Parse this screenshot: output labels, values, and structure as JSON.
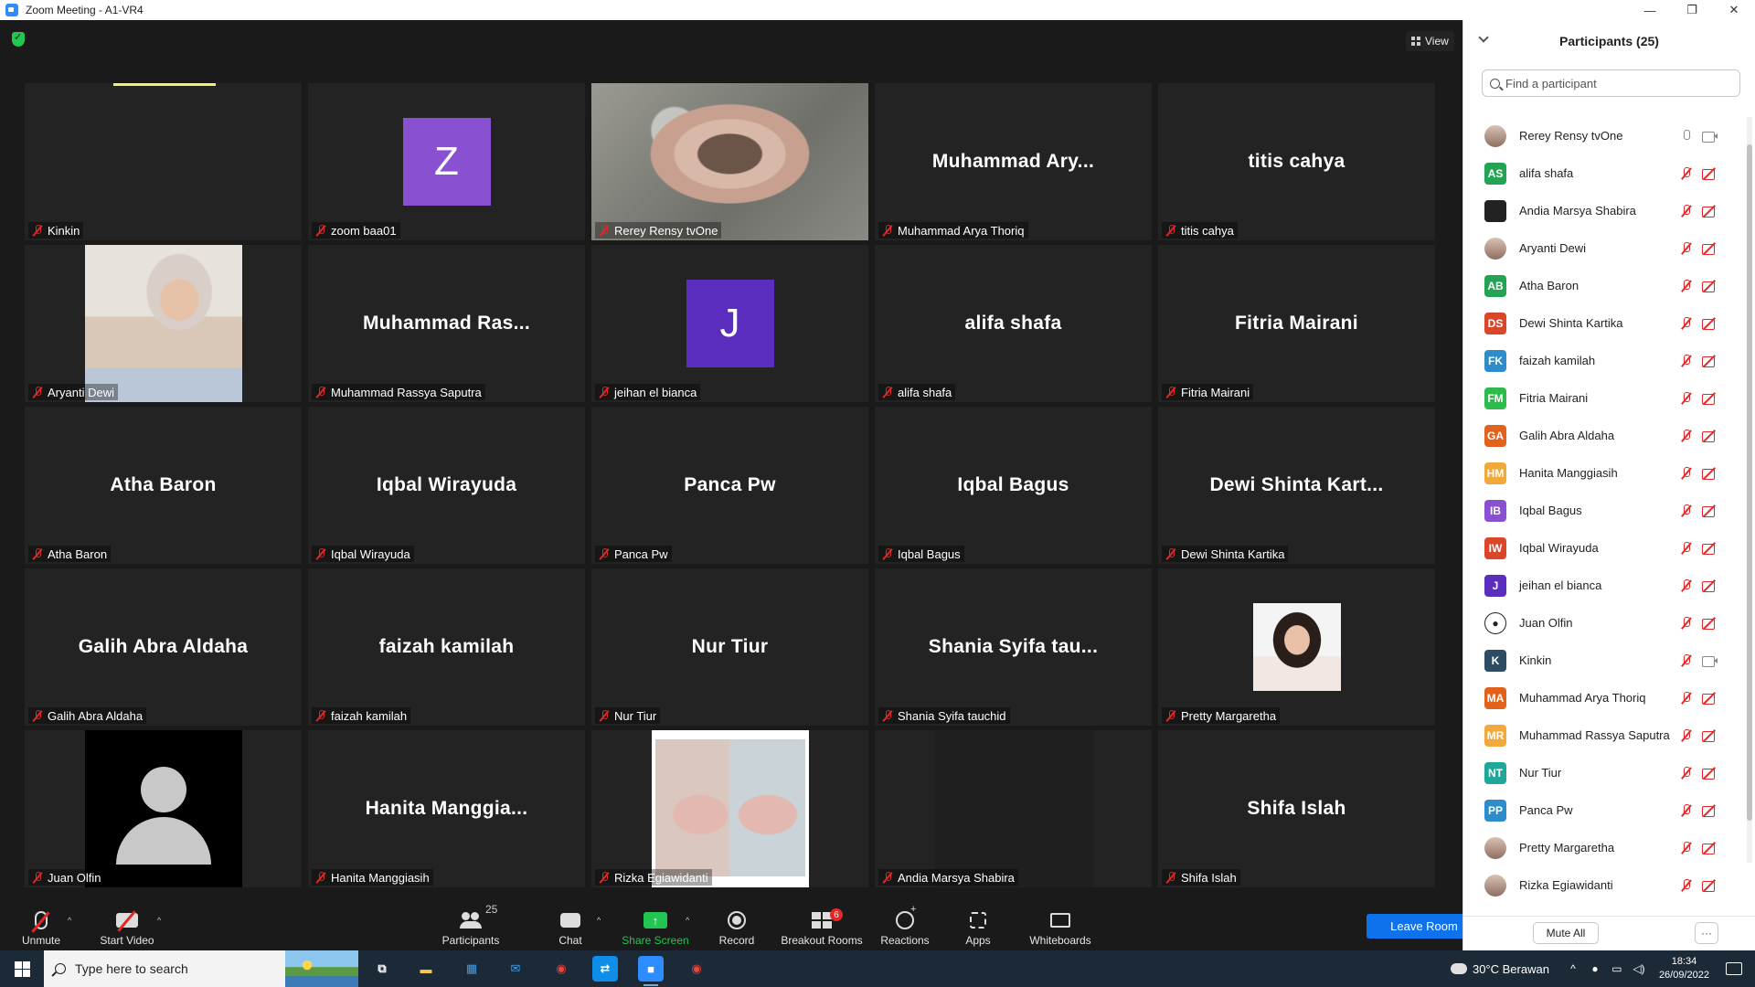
{
  "window": {
    "title": "Zoom Meeting - A1-VR4",
    "minimize_glyph": "—",
    "restore_glyph": "❐",
    "close_glyph": "✕"
  },
  "meeting": {
    "view_label": "View",
    "security_icon": "shield-check-icon"
  },
  "tiles": [
    {
      "name": "Kinkin",
      "display": "",
      "kind": "empty",
      "speaking_bar": true
    },
    {
      "name": "zoom baa01",
      "display": "",
      "kind": "letter",
      "letter": "Z",
      "avatar_color": "#8a50d2"
    },
    {
      "name": "Rerey Rensy tvOne",
      "display": "",
      "kind": "video",
      "active": true
    },
    {
      "name": "Muhammad Arya Thoriq",
      "display": "Muhammad  Ary..."
    },
    {
      "name": "titis cahya",
      "display": "titis cahya"
    },
    {
      "name": "Aryanti Dewi",
      "display": "",
      "kind": "photo-aryanti"
    },
    {
      "name": "Muhammad Rassya Saputra",
      "display": "Muhammad  Ras..."
    },
    {
      "name": "jeihan el bianca",
      "display": "",
      "kind": "letter",
      "letter": "J",
      "avatar_color": "#5b2dbf"
    },
    {
      "name": "alifa shafa",
      "display": "alifa shafa"
    },
    {
      "name": "Fitria Mairani",
      "display": "Fitria Mairani"
    },
    {
      "name": "Atha Baron",
      "display": "Atha Baron"
    },
    {
      "name": "Iqbal Wirayuda",
      "display": "Iqbal Wirayuda"
    },
    {
      "name": "Panca Pw",
      "display": "Panca Pw"
    },
    {
      "name": "Iqbal Bagus",
      "display": "Iqbal Bagus"
    },
    {
      "name": "Dewi Shinta Kartika",
      "display": "Dewi Shinta Kart..."
    },
    {
      "name": "Galih Abra Aldaha",
      "display": "Galih Abra Aldaha"
    },
    {
      "name": "faizah kamilah",
      "display": "faizah kamilah"
    },
    {
      "name": "Nur Tiur",
      "display": "Nur Tiur"
    },
    {
      "name": "Shania Syifa tauchid",
      "display": "Shania  Syifa  tau..."
    },
    {
      "name": "Pretty Margaretha",
      "display": "",
      "kind": "photo-pretty"
    },
    {
      "name": "Juan Olfin",
      "display": "",
      "kind": "photo-juan"
    },
    {
      "name": "Hanita Manggiasih",
      "display": "Hanita  Manggia..."
    },
    {
      "name": "Rizka Egiawidanti",
      "display": "",
      "kind": "photo-rizka"
    },
    {
      "name": "Andia Marsya Shabira",
      "display": "",
      "kind": "dark"
    },
    {
      "name": "Shifa Islah",
      "display": "Shifa Islah"
    }
  ],
  "toolbar": {
    "unmute": "Unmute",
    "start_video": "Start Video",
    "participants": "Participants",
    "participants_count": "25",
    "chat": "Chat",
    "share_screen": "Share Screen",
    "share_glyph": "↑",
    "record": "Record",
    "breakout_rooms": "Breakout Rooms",
    "breakout_badge": "6",
    "reactions": "Reactions",
    "apps": "Apps",
    "whiteboards": "Whiteboards",
    "leave_room": "Leave Room",
    "caret_glyph": "^"
  },
  "panel": {
    "title": "Participants (25)",
    "search_placeholder": "Find a participant",
    "mute_all": "Mute All",
    "more_glyph": "···",
    "participants": [
      {
        "name": "Rerey Rensy tvOne",
        "initials": "",
        "avatar": "photo",
        "color": "",
        "mic": "on",
        "cam": "on"
      },
      {
        "name": "alifa shafa",
        "initials": "AS",
        "color": "#23a455",
        "mic": "off",
        "cam": "off"
      },
      {
        "name": "Andia Marsya Shabira",
        "initials": "",
        "color": "#222222",
        "mic": "off",
        "cam": "off"
      },
      {
        "name": "Aryanti Dewi",
        "initials": "",
        "avatar": "photo",
        "color": "",
        "mic": "off",
        "cam": "off"
      },
      {
        "name": "Atha Baron",
        "initials": "AB",
        "color": "#23a455",
        "mic": "off",
        "cam": "off"
      },
      {
        "name": "Dewi Shinta Kartika",
        "initials": "DS",
        "color": "#d9462a",
        "mic": "off",
        "cam": "off"
      },
      {
        "name": "faizah kamilah",
        "initials": "FK",
        "color": "#2d8cc9",
        "mic": "off",
        "cam": "off"
      },
      {
        "name": "Fitria Mairani",
        "initials": "FM",
        "color": "#2fba4c",
        "mic": "off",
        "cam": "off"
      },
      {
        "name": "Galih Abra Aldaha",
        "initials": "GA",
        "color": "#e2621c",
        "mic": "off",
        "cam": "off"
      },
      {
        "name": "Hanita Manggiasih",
        "initials": "HM",
        "color": "#f2a93b",
        "mic": "off",
        "cam": "off"
      },
      {
        "name": "Iqbal Bagus",
        "initials": "IB",
        "color": "#8a50d2",
        "mic": "off",
        "cam": "off"
      },
      {
        "name": "Iqbal Wirayuda",
        "initials": "IW",
        "color": "#d9462a",
        "mic": "off",
        "cam": "off"
      },
      {
        "name": "jeihan el bianca",
        "initials": "J",
        "color": "#5b2dbf",
        "mic": "off",
        "cam": "off"
      },
      {
        "name": "Juan Olfin",
        "initials": "",
        "avatar": "default",
        "color": "#ffffff",
        "mic": "off",
        "cam": "off"
      },
      {
        "name": "Kinkin",
        "initials": "K",
        "color": "#2e4b66",
        "mic": "off",
        "cam": "on"
      },
      {
        "name": "Muhammad Arya Thoriq",
        "initials": "MA",
        "color": "#e2621c",
        "mic": "off",
        "cam": "off"
      },
      {
        "name": "Muhammad Rassya Saputra",
        "initials": "MR",
        "color": "#f2a93b",
        "mic": "off",
        "cam": "off"
      },
      {
        "name": "Nur Tiur",
        "initials": "NT",
        "color": "#21a79a",
        "mic": "off",
        "cam": "off"
      },
      {
        "name": "Panca Pw",
        "initials": "PP",
        "color": "#2d8cc9",
        "mic": "off",
        "cam": "off"
      },
      {
        "name": "Pretty Margaretha",
        "initials": "",
        "avatar": "photo",
        "color": "",
        "mic": "off",
        "cam": "off"
      },
      {
        "name": "Rizka Egiawidanti",
        "initials": "",
        "avatar": "photo",
        "color": "",
        "mic": "off",
        "cam": "off"
      }
    ]
  },
  "taskbar": {
    "search_placeholder": "Type here to search",
    "weather": "30°C  Berawan",
    "tray_chevron": "^",
    "time": "18:34",
    "date": "26/09/2022",
    "apps": [
      {
        "id": "task-view",
        "glyph": "⧉",
        "color": "#ffffff",
        "bg": ""
      },
      {
        "id": "file-explorer",
        "glyph": "▬",
        "color": "#f2c94c",
        "bg": ""
      },
      {
        "id": "store",
        "glyph": "▦",
        "color": "#3aa0f0",
        "bg": ""
      },
      {
        "id": "mail",
        "glyph": "✉",
        "color": "#3aa0f0",
        "bg": ""
      },
      {
        "id": "chrome",
        "glyph": "◉",
        "color": "#e8453c",
        "bg": ""
      },
      {
        "id": "teamviewer",
        "glyph": "⇄",
        "color": "#ffffff",
        "bg": "#0e8ee9"
      },
      {
        "id": "zoom",
        "glyph": "■",
        "color": "#ffffff",
        "bg": "#2d8cff",
        "active": true
      },
      {
        "id": "chrome-2",
        "glyph": "◉",
        "color": "#e8453c",
        "bg": ""
      }
    ]
  }
}
